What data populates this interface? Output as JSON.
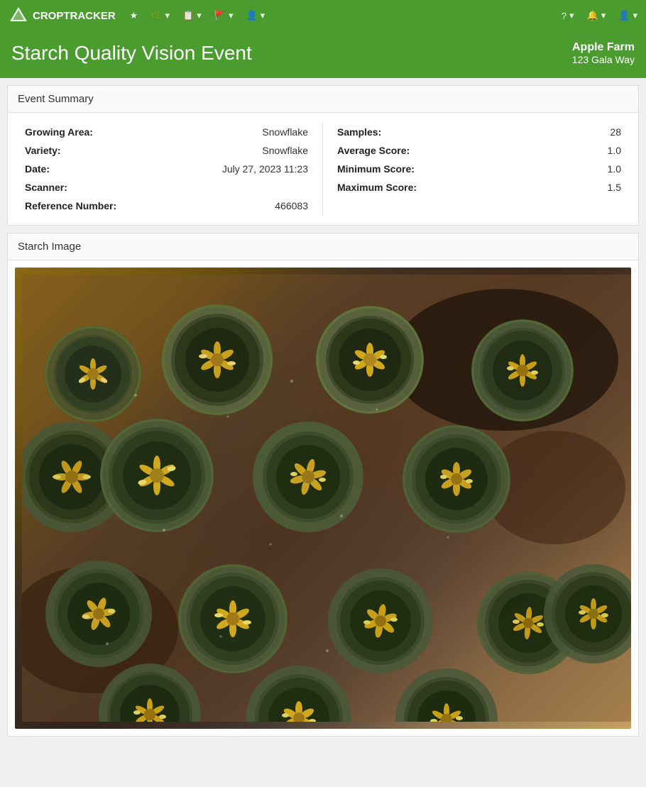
{
  "navbar": {
    "brand": "CROPTRACKER",
    "nav_items": [
      {
        "label": "▲",
        "icon": "bookmark-icon"
      },
      {
        "label": "🌿▾",
        "icon": "crops-icon"
      },
      {
        "label": "📋▾",
        "icon": "records-icon"
      },
      {
        "label": "🚩▾",
        "icon": "flags-icon"
      },
      {
        "label": "👤▾",
        "icon": "people-icon"
      }
    ],
    "right_items": [
      {
        "label": "?▾",
        "icon": "help-icon"
      },
      {
        "label": "🔔▾",
        "icon": "notifications-icon"
      },
      {
        "label": "👤▾",
        "icon": "account-icon"
      }
    ]
  },
  "page": {
    "title": "Starch Quality Vision Event",
    "farm_name": "Apple Farm",
    "farm_address": "123 Gala Way"
  },
  "event_summary": {
    "section_title": "Event Summary",
    "fields": {
      "growing_area_label": "Growing Area:",
      "growing_area_value": "Snowflake",
      "variety_label": "Variety:",
      "variety_value": "Snowflake",
      "date_label": "Date:",
      "date_value": "July 27, 2023 11:23",
      "scanner_label": "Scanner:",
      "scanner_value": "",
      "reference_label": "Reference Number:",
      "reference_value": "466083"
    },
    "right_fields": {
      "samples_label": "Samples:",
      "samples_value": "28",
      "avg_score_label": "Average Score:",
      "avg_score_value": "1.0",
      "min_score_label": "Minimum Score:",
      "min_score_value": "1.0",
      "max_score_label": "Maximum Score:",
      "max_score_value": "1.5"
    }
  },
  "starch_image": {
    "section_title": "Starch Image"
  }
}
